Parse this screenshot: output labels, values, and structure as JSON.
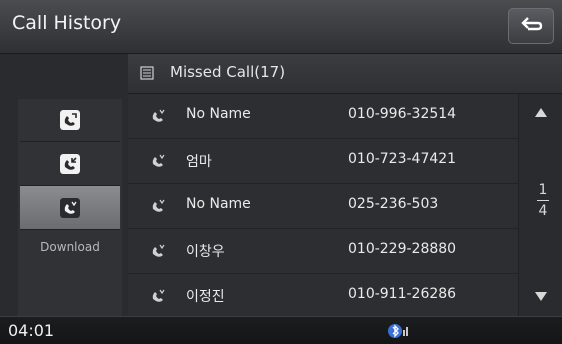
{
  "header": {
    "title": "Call History"
  },
  "subheader": {
    "label": "Missed Call(17)"
  },
  "sidebar": {
    "items": [
      {
        "icon": "dialed-call-icon",
        "color": "#ffffff"
      },
      {
        "icon": "received-call-icon",
        "color": "#ffffff"
      },
      {
        "icon": "missed-call-icon",
        "color": "#ffffff"
      }
    ],
    "download_label": "Download"
  },
  "list": {
    "rows": [
      {
        "name": "No Name",
        "number": "010-996-32514"
      },
      {
        "name": "엄마",
        "number": "010-723-47421"
      },
      {
        "name": "No Name",
        "number": "025-236-503"
      },
      {
        "name": "이창우",
        "number": "010-229-28880"
      },
      {
        "name": "이정진",
        "number": "010-911-26286"
      }
    ]
  },
  "scroll": {
    "page_current": "1",
    "page_total": "4"
  },
  "status": {
    "time": "04:01"
  }
}
